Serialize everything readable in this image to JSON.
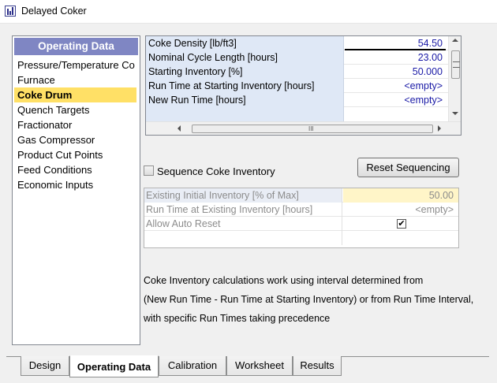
{
  "window": {
    "title": "Delayed Coker"
  },
  "nav": {
    "header": "Operating Data",
    "items": [
      {
        "label": "Pressure/Temperature Co",
        "selected": false
      },
      {
        "label": "Furnace",
        "selected": false
      },
      {
        "label": "Coke Drum",
        "selected": true
      },
      {
        "label": "Quench Targets",
        "selected": false
      },
      {
        "label": "Fractionator",
        "selected": false
      },
      {
        "label": "Gas Compressor",
        "selected": false
      },
      {
        "label": "Product Cut Points",
        "selected": false
      },
      {
        "label": "Feed Conditions",
        "selected": false
      },
      {
        "label": "Economic Inputs",
        "selected": false
      }
    ]
  },
  "properties": {
    "rows": [
      {
        "label": "Coke Density [lb/ft3]",
        "value": "54.50"
      },
      {
        "label": "Nominal Cycle Length [hours]",
        "value": "23.00"
      },
      {
        "label": "Starting Inventory [%]",
        "value": "50.000"
      },
      {
        "label": "Run Time at Starting Inventory [hours]",
        "value": "<empty>"
      },
      {
        "label": "New Run Time [hours]",
        "value": "<empty>"
      }
    ],
    "scroll_grip": "III"
  },
  "sequence": {
    "checkbox_label": "Sequence Coke Inventory",
    "checked": false,
    "reset_button": "Reset Sequencing"
  },
  "inventory": {
    "rows": [
      {
        "label": "Existing Initial Inventory [% of Max]",
        "value": "50.00"
      },
      {
        "label": "Run Time at Existing Inventory [hours]",
        "value": "<empty>"
      },
      {
        "label": "Allow Auto Reset",
        "value": ""
      }
    ],
    "auto_reset_checked": true,
    "check_mark": "✔"
  },
  "info": {
    "lines": [
      "Coke Inventory calculations work using interval determined from",
      "(New Run Time - Run Time at Starting Inventory) or from Run Time Interval,",
      "with specific Run Times taking precedence"
    ]
  },
  "tabs": [
    {
      "label": "Design",
      "active": false
    },
    {
      "label": "Operating Data",
      "active": true
    },
    {
      "label": "Calibration",
      "active": false
    },
    {
      "label": "Worksheet",
      "active": false
    },
    {
      "label": "Results",
      "active": false
    }
  ]
}
